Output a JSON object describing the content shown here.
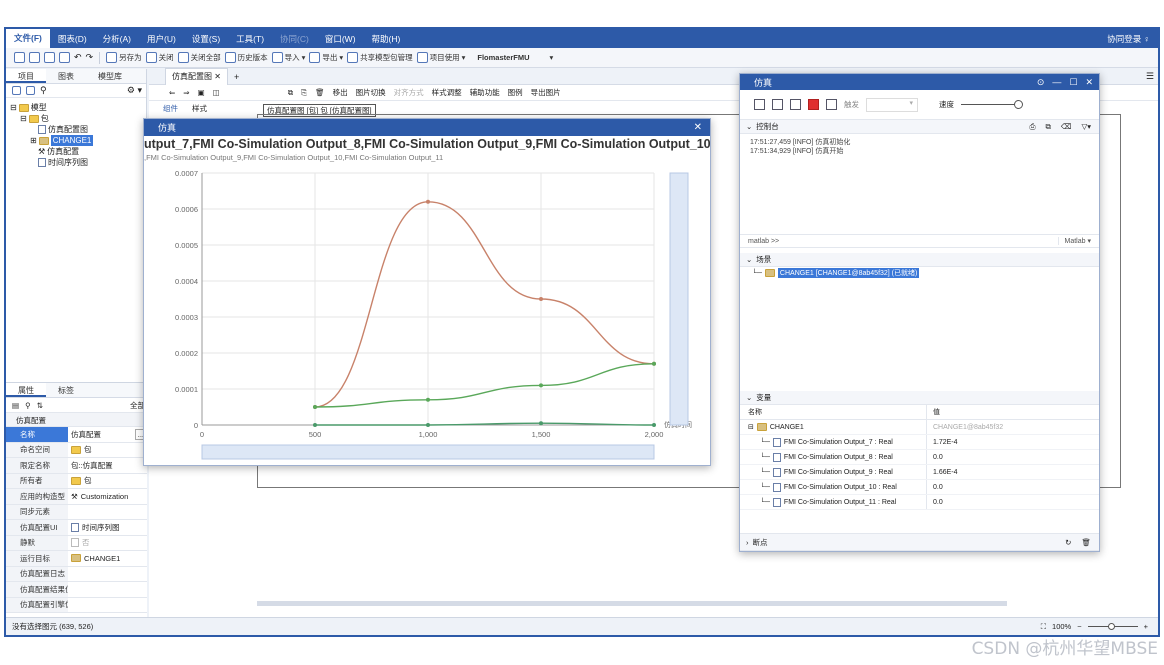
{
  "menu": {
    "items": [
      "文件(F)",
      "图表(D)",
      "分析(A)",
      "用户(U)",
      "设置(S)",
      "工具(T)",
      "协同(C)",
      "窗口(W)",
      "帮助(H)"
    ],
    "right": "协同登录 ♀"
  },
  "toolbar": {
    "save_as": "另存为",
    "close": "关闭",
    "close_all": "关闭全部",
    "history": "历史版本",
    "import": "导入",
    "export": "导出",
    "shared_model": "共享模型包管理",
    "project_use": "项目使用",
    "fmu": "FlomasterFMU"
  },
  "left": {
    "tabs": [
      "项目",
      "图表",
      "模型库"
    ],
    "tree": [
      "模型",
      "包",
      "仿真配置图",
      "CHANGE1",
      "仿真配置",
      "时间序列图"
    ]
  },
  "props": {
    "tabs": [
      "属性",
      "标签"
    ],
    "all_label": "全部",
    "section": "仿真配置",
    "rows": [
      {
        "k": "名称",
        "v": "仿真配置"
      },
      {
        "k": "命名空间",
        "v": "包"
      },
      {
        "k": "限定名称",
        "v": "包::仿真配置"
      },
      {
        "k": "所有者",
        "v": "包"
      },
      {
        "k": "应用的构造型",
        "v": "Customization"
      },
      {
        "k": "同步元素",
        "v": ""
      },
      {
        "k": "仿真配置UI",
        "v": "时间序列图"
      },
      {
        "k": "静默",
        "v": "否"
      },
      {
        "k": "运行目标",
        "v": "CHANGE1"
      },
      {
        "k": "仿真配置日志",
        "v": ""
      },
      {
        "k": "仿真配置结果位置",
        "v": ""
      },
      {
        "k": "仿真配置引擎优...",
        "v": ""
      }
    ]
  },
  "center": {
    "tab": "仿真配置图",
    "sub_tabs": [
      "组件",
      "样式"
    ],
    "diagram_label": "仿真配置图 [包] 包 [仿真配置图]",
    "toolbar": [
      "移出",
      "图片切换",
      "对齐方式",
      "样式调整",
      "辅助功能",
      "图例",
      "导出图片"
    ]
  },
  "status": {
    "left": "没有选择图元 (639, 526)",
    "zoom": "100%"
  },
  "chart_window": {
    "title": "仿真",
    "heading": "utput_7,FMI Co-Simulation Output_8,FMI Co-Simulation Output_9,FMI Co-Simulation Output_10,FMI Co-S",
    "subheading": ",FMI Co-Simulation Output_9,FMI Co-Simulation Output_10,FMI Co-Simulation Output_11",
    "x_end_label": "仿真时间"
  },
  "chart_data": {
    "type": "line",
    "x": [
      500,
      1000,
      1500,
      2000
    ],
    "xlim": [
      0,
      2000
    ],
    "ylim": [
      0,
      0.0007
    ],
    "xticks": [
      "0",
      "500",
      "1,000",
      "1,500",
      "2,000"
    ],
    "yticks": [
      "0",
      "0.0001",
      "0.0002",
      "0.0003",
      "0.0004",
      "0.0005",
      "0.0006",
      "0.0007"
    ],
    "grid": true,
    "series": [
      {
        "values": [
          5e-05,
          0.00062,
          0.00035,
          0.00017
        ],
        "color": "#c8826a"
      },
      {
        "values": [
          5e-05,
          7e-05,
          0.00011,
          0.00017
        ],
        "color": "#5aa85a"
      },
      {
        "values": [
          0.0,
          0.0,
          5e-06,
          0.0
        ],
        "color": "#4a9a6a"
      }
    ]
  },
  "sim_window": {
    "title": "仿真",
    "trigger": "触发",
    "speed": "速度",
    "console": "控制台",
    "logs": [
      "17:51:27,459  [INFO] 仿真初始化",
      "17:51:34,929  [INFO] 仿真开始"
    ],
    "cmd_prompt": "matlab  >>",
    "cmd_engine": "Matlab",
    "scene": "场景",
    "scene_item": "CHANGE1 [CHANGE1@8ab45f32] (已就绪)",
    "variables": "变量",
    "col_name": "名称",
    "col_value": "值",
    "root": {
      "name": "CHANGE1",
      "value": "CHANGE1@8ab45f32"
    },
    "vars": [
      {
        "name": "FMI Co-Simulation Output_7 : Real",
        "value": "1.72E-4"
      },
      {
        "name": "FMI Co-Simulation Output_8 : Real",
        "value": "0.0"
      },
      {
        "name": "FMI Co-Simulation Output_9 : Real",
        "value": "1.66E-4"
      },
      {
        "name": "FMI Co-Simulation Output_10 : Real",
        "value": "0.0"
      },
      {
        "name": "FMI Co-Simulation Output_11 : Real",
        "value": "0.0"
      }
    ],
    "breakpoints": "断点"
  },
  "watermark": "CSDN @杭州华望MBSE"
}
